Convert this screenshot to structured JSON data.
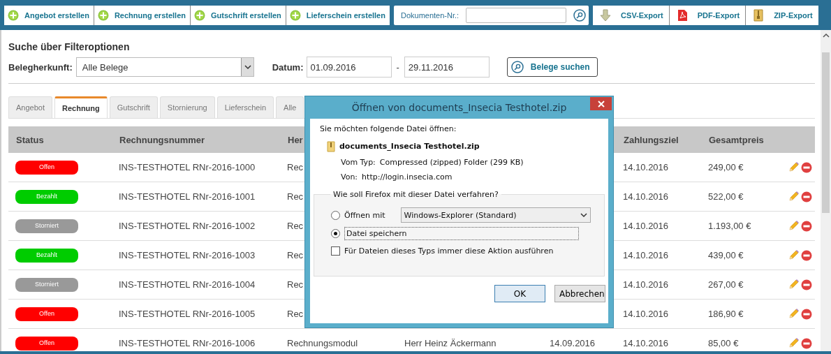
{
  "toolbar": {
    "create_buttons": [
      "Angebot erstellen",
      "Rechnung erstellen",
      "Gutschrift erstellen",
      "Lieferschein erstellen"
    ],
    "document_number": {
      "label": "Dokumenten-Nr.:"
    },
    "export_buttons": [
      {
        "label": "CSV-Export",
        "kind": "csv"
      },
      {
        "label": "PDF-Export",
        "kind": "pdf"
      },
      {
        "label": "ZIP-Export",
        "kind": "zip"
      }
    ]
  },
  "filter": {
    "title": "Suche über Filteroptionen",
    "origin_label": "Belegherkunft:",
    "origin_value": "Alle Belege",
    "date_label": "Datum:",
    "date_from": "01.09.2016",
    "date_separator": "-",
    "date_to": "29.11.2016",
    "search_button": "Belege suchen"
  },
  "tabs": [
    {
      "label": "Angebot",
      "selected": false
    },
    {
      "label": "Rechnung",
      "selected": true
    },
    {
      "label": "Gutschrift",
      "selected": false
    },
    {
      "label": "Stornierung",
      "selected": false
    },
    {
      "label": "Lieferschein",
      "selected": false
    },
    {
      "label": "Alle",
      "selected": false
    }
  ],
  "table": {
    "columns": {
      "status": "Status",
      "rechnungsnummer": "Rechnungsnummer",
      "column_3": "Her",
      "zahlungsziel": "Zahlungsziel",
      "gesamtpreis": "Gesamtpreis"
    },
    "rows": [
      {
        "status": "Offen",
        "color": "#ff0000",
        "rechnungsnummer": "INS-TESTHOTEL RNr-2016-1000",
        "column_3": "Rec",
        "zahlungsziel": "14.10.2016",
        "gesamtpreis": "249,00 €"
      },
      {
        "status": "Bezahlt",
        "color": "#00cc00",
        "rechnungsnummer": "INS-TESTHOTEL RNr-2016-1001",
        "column_3": "Rec",
        "zahlungsziel": "14.10.2016",
        "gesamtpreis": "522,00 €"
      },
      {
        "status": "Storniert",
        "color": "#999999",
        "rechnungsnummer": "INS-TESTHOTEL RNr-2016-1002",
        "column_3": "Rec",
        "zahlungsziel": "14.10.2016",
        "gesamtpreis": "1.193,00 €"
      },
      {
        "status": "Bezahlt",
        "color": "#00cc00",
        "rechnungsnummer": "INS-TESTHOTEL RNr-2016-1003",
        "column_3": "Rec",
        "zahlungsziel": "14.10.2016",
        "gesamtpreis": "439,00 €"
      },
      {
        "status": "Storniert",
        "color": "#999999",
        "rechnungsnummer": "INS-TESTHOTEL RNr-2016-1004",
        "column_3": "Rec",
        "zahlungsziel": "14.10.2016",
        "gesamtpreis": "267,00 €"
      },
      {
        "status": "Offen",
        "color": "#ff0000",
        "rechnungsnummer": "INS-TESTHOTEL RNr-2016-1005",
        "column_3": "Rec",
        "zahlungsziel": "14.10.2016",
        "gesamtpreis": "186,90 €"
      },
      {
        "status": "Offen",
        "color": "#ff0000",
        "rechnungsnummer": "INS-TESTHOTEL RNr-2016-1006",
        "column_3": "Rechnungsmodul",
        "column_4": "Herr Heinz Äckermann",
        "column_5": "14.09.2016",
        "zahlungsziel": "14.10.2016",
        "gesamtpreis": "85,00 €"
      }
    ]
  },
  "dialog": {
    "title": "Öffnen von documents_Insecia Testhotel.zip",
    "intro": "Sie möchten folgende Datei öffnen:",
    "file_name": "documents_Insecia Testhotel.zip",
    "type_label": "Vom Typ:",
    "type_value": "Compressed (zipped) Folder (299 KB)",
    "from_label": "Von:",
    "from_value": "http://login.insecia.com",
    "group_label": "Wie soll Firefox mit dieser Datei verfahren?",
    "options": [
      {
        "kind": "open_with",
        "label": "Öffnen mit",
        "selected": false,
        "application": "Windows-Explorer (Standard)"
      },
      {
        "kind": "save",
        "label": "Datei speichern",
        "selected": true
      }
    ],
    "remember": {
      "label": "Für Dateien dieses Typs immer diese Aktion ausführen",
      "checked": false
    },
    "buttons": [
      "OK",
      "Abbrechen"
    ]
  }
}
